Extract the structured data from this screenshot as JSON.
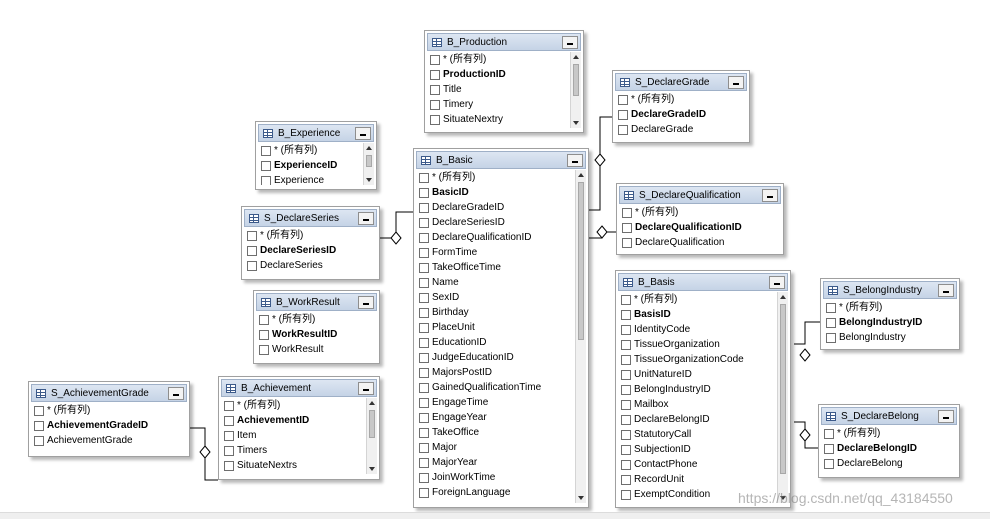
{
  "tables": [
    {
      "id": "B_Production",
      "title": "B_Production",
      "rows": [
        {
          "text": "* (所有列)",
          "bold": false
        },
        {
          "text": "ProductionID",
          "bold": true
        },
        {
          "text": "Title",
          "bold": false
        },
        {
          "text": "Timery",
          "bold": false
        },
        {
          "text": "SituateNextry",
          "bold": false
        }
      ]
    },
    {
      "id": "S_DeclareGrade",
      "title": "S_DeclareGrade",
      "rows": [
        {
          "text": "* (所有列)",
          "bold": false
        },
        {
          "text": "DeclareGradeID",
          "bold": true
        },
        {
          "text": "DeclareGrade",
          "bold": false
        }
      ]
    },
    {
      "id": "B_Experience",
      "title": "B_Experience",
      "rows": [
        {
          "text": "* (所有列)",
          "bold": false
        },
        {
          "text": "ExperienceID",
          "bold": true
        },
        {
          "text": "Experience",
          "bold": false
        }
      ]
    },
    {
      "id": "B_Basic",
      "title": "B_Basic",
      "rows": [
        {
          "text": "* (所有列)",
          "bold": false
        },
        {
          "text": "BasicID",
          "bold": true
        },
        {
          "text": "DeclareGradeID",
          "bold": false
        },
        {
          "text": "DeclareSeriesID",
          "bold": false
        },
        {
          "text": "DeclareQualificationID",
          "bold": false
        },
        {
          "text": "FormTime",
          "bold": false
        },
        {
          "text": "TakeOfficeTime",
          "bold": false
        },
        {
          "text": "Name",
          "bold": false
        },
        {
          "text": "SexID",
          "bold": false
        },
        {
          "text": "Birthday",
          "bold": false
        },
        {
          "text": "PlaceUnit",
          "bold": false
        },
        {
          "text": "EducationID",
          "bold": false
        },
        {
          "text": "JudgeEducationID",
          "bold": false
        },
        {
          "text": "MajorsPostID",
          "bold": false
        },
        {
          "text": "GainedQualificationTime",
          "bold": false
        },
        {
          "text": "EngageTime",
          "bold": false
        },
        {
          "text": "EngageYear",
          "bold": false
        },
        {
          "text": "TakeOffice",
          "bold": false
        },
        {
          "text": "Major",
          "bold": false
        },
        {
          "text": "MajorYear",
          "bold": false
        },
        {
          "text": "JoinWorkTime",
          "bold": false
        },
        {
          "text": "ForeignLanguage",
          "bold": false
        }
      ]
    },
    {
      "id": "S_DeclareQualification",
      "title": "S_DeclareQualification",
      "rows": [
        {
          "text": "* (所有列)",
          "bold": false
        },
        {
          "text": "DeclareQualificationID",
          "bold": true
        },
        {
          "text": "DeclareQualification",
          "bold": false
        }
      ]
    },
    {
      "id": "S_DeclareSeries",
      "title": "S_DeclareSeries",
      "rows": [
        {
          "text": "* (所有列)",
          "bold": false
        },
        {
          "text": "DeclareSeriesID",
          "bold": true
        },
        {
          "text": "DeclareSeries",
          "bold": false
        }
      ]
    },
    {
      "id": "B_WorkResult",
      "title": "B_WorkResult",
      "rows": [
        {
          "text": "* (所有列)",
          "bold": false
        },
        {
          "text": "WorkResultID",
          "bold": true
        },
        {
          "text": "WorkResult",
          "bold": false
        }
      ]
    },
    {
      "id": "B_Basis",
      "title": "B_Basis",
      "rows": [
        {
          "text": "* (所有列)",
          "bold": false
        },
        {
          "text": "BasisID",
          "bold": true
        },
        {
          "text": "IdentityCode",
          "bold": false
        },
        {
          "text": "TissueOrganization",
          "bold": false
        },
        {
          "text": "TissueOrganizationCode",
          "bold": false
        },
        {
          "text": "UnitNatureID",
          "bold": false
        },
        {
          "text": "BelongIndustryID",
          "bold": false
        },
        {
          "text": "Mailbox",
          "bold": false
        },
        {
          "text": "DeclareBelongID",
          "bold": false
        },
        {
          "text": "StatutoryCall",
          "bold": false
        },
        {
          "text": "SubjectionID",
          "bold": false
        },
        {
          "text": "ContactPhone",
          "bold": false
        },
        {
          "text": "RecordUnit",
          "bold": false
        },
        {
          "text": "ExemptCondition",
          "bold": false
        }
      ]
    },
    {
      "id": "S_BelongIndustry",
      "title": "S_BelongIndustry",
      "rows": [
        {
          "text": "* (所有列)",
          "bold": false
        },
        {
          "text": "BelongIndustryID",
          "bold": true
        },
        {
          "text": "BelongIndustry",
          "bold": false
        }
      ]
    },
    {
      "id": "S_AchievementGrade",
      "title": "S_AchievementGrade",
      "rows": [
        {
          "text": "* (所有列)",
          "bold": false
        },
        {
          "text": "AchievementGradeID",
          "bold": true
        },
        {
          "text": "AchievementGrade",
          "bold": false
        }
      ]
    },
    {
      "id": "B_Achievement",
      "title": "B_Achievement",
      "rows": [
        {
          "text": "* (所有列)",
          "bold": false
        },
        {
          "text": "AchievementID",
          "bold": true
        },
        {
          "text": "Item",
          "bold": false
        },
        {
          "text": "Timers",
          "bold": false
        },
        {
          "text": "SituateNextrs",
          "bold": false
        }
      ]
    },
    {
      "id": "S_DeclareBelong",
      "title": "S_DeclareBelong",
      "rows": [
        {
          "text": "* (所有列)",
          "bold": false
        },
        {
          "text": "DeclareBelongID",
          "bold": true
        },
        {
          "text": "DeclareBelong",
          "bold": false
        }
      ]
    }
  ],
  "watermark": "https://blog.csdn.net/qq_43184550"
}
